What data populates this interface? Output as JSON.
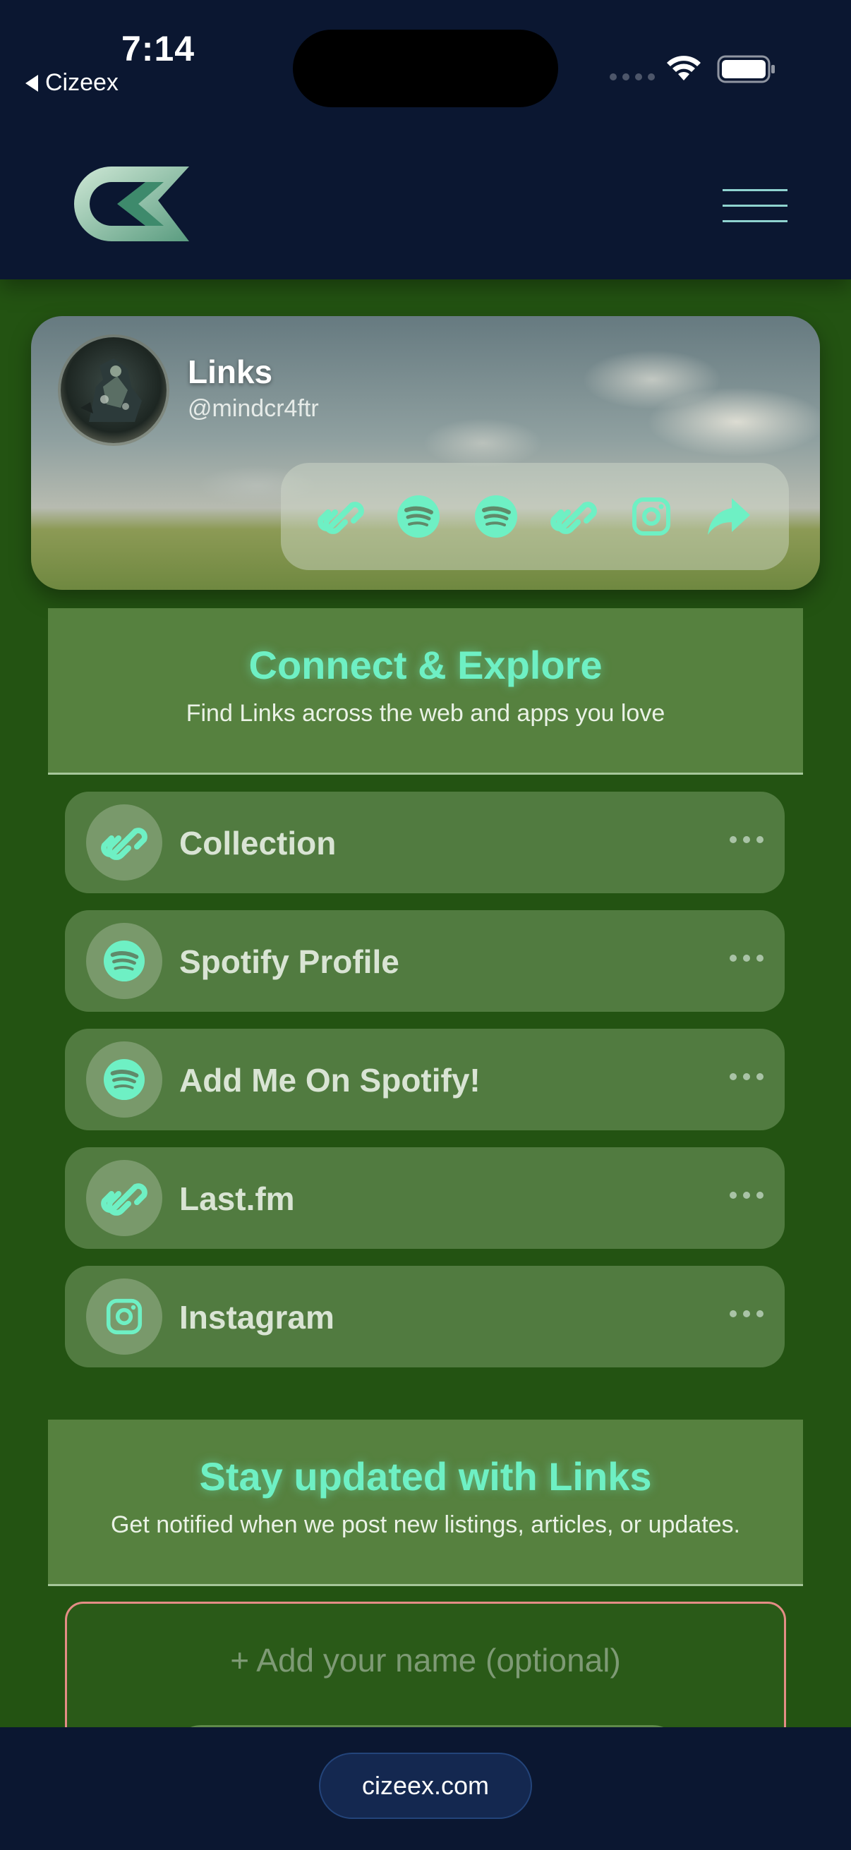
{
  "status_bar": {
    "time": "7:14",
    "back_app": "Cizeex"
  },
  "header": {
    "logo_icon": "cizeex-logo-icon",
    "menu_icon": "hamburger-menu-icon"
  },
  "profile": {
    "name": "Links",
    "handle": "@mindcr4ftr",
    "quick_links": [
      {
        "icon": "link-icon"
      },
      {
        "icon": "spotify-icon"
      },
      {
        "icon": "spotify-icon"
      },
      {
        "icon": "link-icon"
      },
      {
        "icon": "instagram-icon"
      },
      {
        "icon": "share-icon"
      }
    ]
  },
  "connect_section": {
    "title": "Connect & Explore",
    "subtitle": "Find Links across the web and apps you love"
  },
  "links": [
    {
      "label": "Collection",
      "icon": "link-icon"
    },
    {
      "label": "Spotify Profile",
      "icon": "spotify-icon"
    },
    {
      "label": "Add Me On Spotify!",
      "icon": "spotify-icon"
    },
    {
      "label": "Last.fm",
      "icon": "link-icon"
    },
    {
      "label": "Instagram",
      "icon": "instagram-icon"
    }
  ],
  "subscribe_section": {
    "title": "Stay updated with Links",
    "subtitle": "Get notified when we post new listings, articles, or updates.",
    "name_placeholder": "+ Add your name (optional)"
  },
  "footer": {
    "domain": "cizeex.com"
  },
  "colors": {
    "accent": "#6ef0c4",
    "background": "#235312",
    "navy": "#0b1731",
    "card": "#517b40"
  }
}
